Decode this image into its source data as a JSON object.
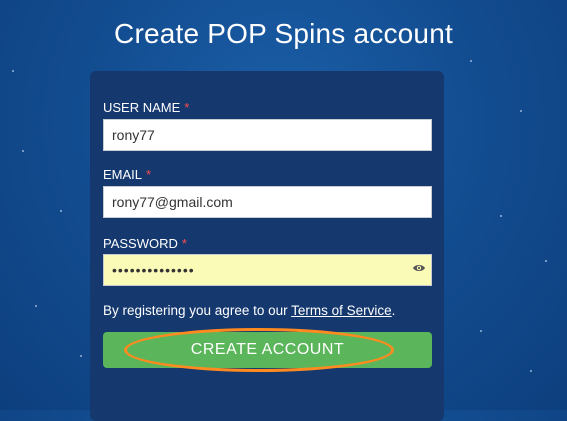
{
  "page": {
    "title": "Create POP Spins account"
  },
  "form": {
    "username": {
      "label": "USER NAME",
      "required_mark": "*",
      "value": "rony77"
    },
    "email": {
      "label": "EMAIL",
      "required_mark": "*",
      "value": "rony77@gmail.com"
    },
    "password": {
      "label": "PASSWORD",
      "required_mark": "*",
      "value": "••••••••••••••",
      "toggle_icon": "eye-icon"
    },
    "agreement": {
      "prefix": "By registering you agree to our ",
      "link": "Terms of Service",
      "suffix": "."
    },
    "submit_label": "CREATE ACCOUNT"
  },
  "colors": {
    "background": "#134e92",
    "card": "#15386f",
    "button": "#5bb55a",
    "highlight_ring": "#ff8a1f",
    "required": "#ff4d4d",
    "password_bg": "#fbfbb8"
  }
}
